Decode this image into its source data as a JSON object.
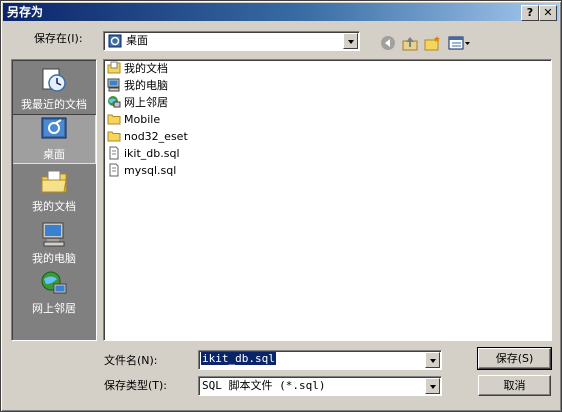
{
  "title": "另存为",
  "title_buttons": {
    "help": "?",
    "close": "✕"
  },
  "save_in": {
    "label": "保存在(I):",
    "value": "桌面"
  },
  "places": [
    {
      "label": "我最近的文档",
      "icon": "recent-documents-icon"
    },
    {
      "label": "桌面",
      "icon": "desktop-icon",
      "selected": true
    },
    {
      "label": "我的文档",
      "icon": "my-documents-icon"
    },
    {
      "label": "我的电脑",
      "icon": "my-computer-icon"
    },
    {
      "label": "网上邻居",
      "icon": "network-places-icon"
    }
  ],
  "files": [
    {
      "name": "我的文档",
      "icon": "my-documents-icon"
    },
    {
      "name": "我的电脑",
      "icon": "my-computer-icon"
    },
    {
      "name": "网上邻居",
      "icon": "network-places-icon"
    },
    {
      "name": "Mobile",
      "icon": "folder-icon"
    },
    {
      "name": "nod32_eset",
      "icon": "folder-icon"
    },
    {
      "name": "ikit_db.sql",
      "icon": "file-icon"
    },
    {
      "name": "mysql.sql",
      "icon": "file-icon"
    }
  ],
  "filename": {
    "label": "文件名(N):",
    "value": "ikit_db.sql"
  },
  "filetype": {
    "label": "保存类型(T):",
    "value": "SQL 脚本文件 (*.sql)"
  },
  "buttons": {
    "save": "保存(S)",
    "cancel": "取消"
  },
  "colors": {
    "title_start": "#0a246a",
    "title_end": "#a6caf0",
    "dialog_bg": "#d4d0c8",
    "places_bg": "#808080",
    "selection": "#0a246a"
  }
}
